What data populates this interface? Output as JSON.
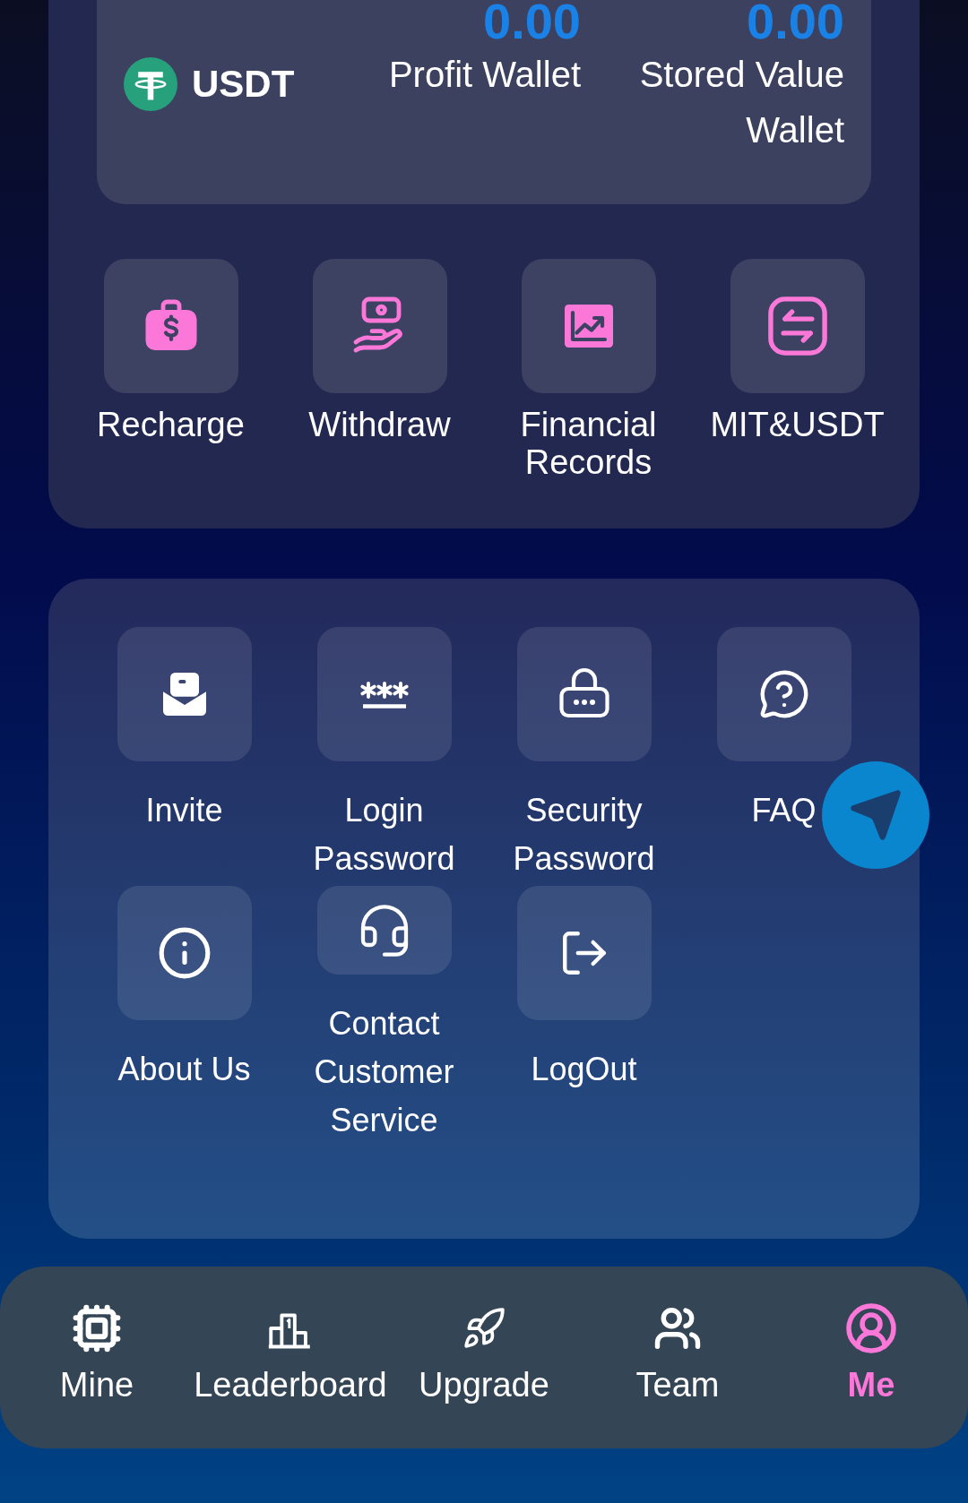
{
  "wallet": {
    "currency": "USDT",
    "balances": [
      {
        "amount": "0.00",
        "label": "Profit Wallet"
      },
      {
        "amount": "0.00",
        "label": "Stored Value Wallet"
      }
    ]
  },
  "actions": [
    {
      "label": "Recharge"
    },
    {
      "label": "Withdraw"
    },
    {
      "label": "Financial Records"
    },
    {
      "label": "MIT&USDT"
    }
  ],
  "menu": [
    {
      "label": "Invite"
    },
    {
      "label": "Login Password"
    },
    {
      "label": "Security Password"
    },
    {
      "label": "FAQ"
    },
    {
      "label": "About Us"
    },
    {
      "label": "Contact Customer Service"
    },
    {
      "label": "LogOut"
    }
  ],
  "nav": [
    {
      "label": "Mine",
      "selected": false
    },
    {
      "label": "Leaderboard",
      "selected": false
    },
    {
      "label": "Upgrade",
      "selected": false
    },
    {
      "label": "Team",
      "selected": false
    },
    {
      "label": "Me",
      "selected": true
    }
  ]
}
